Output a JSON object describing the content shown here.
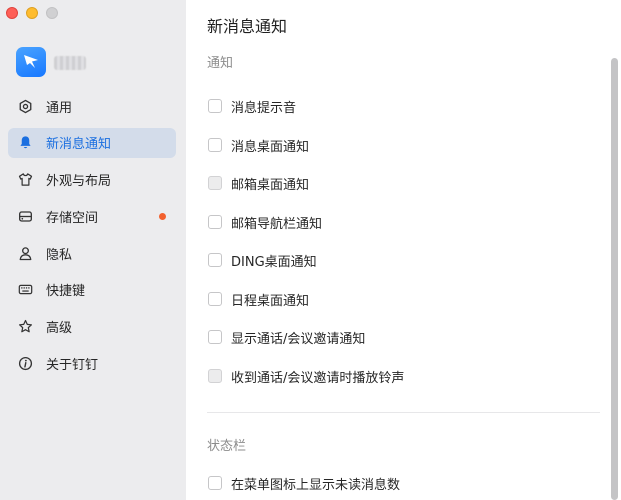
{
  "window": {
    "traffic_lights": [
      "red",
      "yellow",
      "gray"
    ]
  },
  "colors": {
    "accent": "#1b6fe0",
    "active_bg": "#d3dcea",
    "badge": "#f2602e"
  },
  "sidebar": {
    "items": [
      {
        "label": "通用",
        "icon": "gear-icon"
      },
      {
        "label": "新消息通知",
        "icon": "bell-icon",
        "active": true
      },
      {
        "label": "外观与布局",
        "icon": "shirt-icon"
      },
      {
        "label": "存储空间",
        "icon": "storage-icon",
        "badge": true
      },
      {
        "label": "隐私",
        "icon": "person-icon"
      },
      {
        "label": "快捷键",
        "icon": "keyboard-icon"
      },
      {
        "label": "高级",
        "icon": "star-icon"
      },
      {
        "label": "关于钉钉",
        "icon": "info-icon"
      }
    ]
  },
  "main": {
    "title": "新消息通知",
    "sections": [
      {
        "title": "通知",
        "options": [
          {
            "label": "消息提示音",
            "checked": false
          },
          {
            "label": "消息桌面通知",
            "checked": false
          },
          {
            "label": "邮箱桌面通知",
            "checked": false,
            "disabled": true
          },
          {
            "label": "邮箱导航栏通知",
            "checked": false
          },
          {
            "label": "DING桌面通知",
            "checked": false
          },
          {
            "label": "日程桌面通知",
            "checked": false
          },
          {
            "label": "显示通话/会议邀请通知",
            "checked": false
          },
          {
            "label": "收到通话/会议邀请时播放铃声",
            "checked": false,
            "disabled": true
          }
        ]
      },
      {
        "title": "状态栏",
        "options": [
          {
            "label": "在菜单图标上显示未读消息数",
            "checked": false
          }
        ]
      }
    ]
  }
}
